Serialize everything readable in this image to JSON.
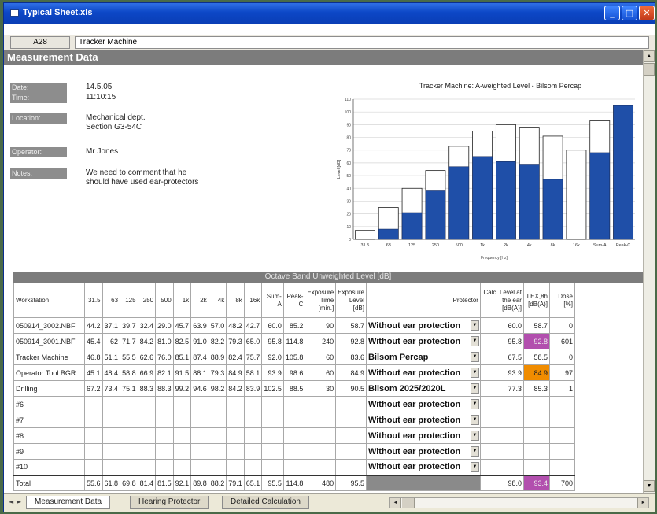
{
  "window": {
    "title": "Typical Sheet.xls",
    "min": "_",
    "max": "□",
    "close": "✕"
  },
  "formula_bar": {
    "cell_ref": "A28",
    "cell_value": "Tracker Machine"
  },
  "section_title": "Measurement Data",
  "info": [
    {
      "label": "Date:",
      "value": "14.5.05"
    },
    {
      "label": "Time:",
      "value": "11:10:15"
    },
    {
      "label": "Location:",
      "value": "Mechanical dept.\nSection G3-54C"
    },
    {
      "label": "Operator:",
      "value": "Mr Jones"
    },
    {
      "label": "Notes:",
      "value": "We need to comment that he\nshould have used ear-protectors"
    }
  ],
  "chart_data": {
    "type": "bar",
    "title": "Tracker Machine: A-weighted Level - Bilsom Percap",
    "xlabel": "Frequency [Hz]",
    "ylabel": "Level [dB]",
    "ylim": [
      0,
      110
    ],
    "yticks": [
      "0",
      "10",
      "20",
      "30",
      "40",
      "50",
      "60",
      "70",
      "80",
      "90",
      "100",
      "110"
    ],
    "categories": [
      "31.5",
      "63",
      "125",
      "250",
      "500",
      "1k",
      "2k",
      "4k",
      "8k",
      "16k",
      "Sum-A",
      "Peak-C"
    ],
    "series": [
      {
        "name": "",
        "values": [
          0,
          8,
          21,
          38,
          57,
          65,
          61,
          59,
          47,
          0,
          68,
          105
        ],
        "color": "#1f4fa8"
      },
      {
        "name": "",
        "values": [
          7,
          25,
          40,
          54,
          73,
          85,
          90,
          88,
          81,
          70,
          93,
          105
        ],
        "color": "#ffffff"
      }
    ],
    "grid": true
  },
  "octave_title": "Octave Band Unweighted Level [dB]",
  "table": {
    "headers": [
      "Workstation",
      "31.5",
      "63",
      "125",
      "250",
      "500",
      "1k",
      "2k",
      "4k",
      "8k",
      "16k",
      "Sum-A",
      "Peak-C",
      "Exposure Time [min.]",
      "Exposure Level [dB]",
      "Protector",
      "Calc. Level at the ear [dB(A)]",
      "LEX,8h [dB(A)]",
      "Dose [%]"
    ],
    "rows": [
      {
        "cells": [
          "050914_3002.NBF",
          "44.2",
          "37.1",
          "39.7",
          "32.4",
          "29.0",
          "45.7",
          "63.9",
          "57.0",
          "48.2",
          "42.7",
          "60.0",
          "85.2",
          "90",
          "58.7",
          "Without ear protection",
          "60.0",
          "58.7",
          "0"
        ],
        "hl": {}
      },
      {
        "cells": [
          "050914_3001.NBF",
          "45.4",
          "62",
          "71.7",
          "84.2",
          "81.0",
          "82.5",
          "91.0",
          "82.2",
          "79.3",
          "65.0",
          "95.8",
          "114.8",
          "240",
          "92.8",
          "Without ear protection",
          "95.8",
          "92.8",
          "601"
        ],
        "hl": {
          "17": "magenta"
        }
      },
      {
        "cells": [
          "Tracker Machine",
          "46.8",
          "51.1",
          "55.5",
          "62.6",
          "76.0",
          "85.1",
          "87.4",
          "88.9",
          "82.4",
          "75.7",
          "92.0",
          "105.8",
          "60",
          "83.6",
          "Bilsom Percap",
          "67.5",
          "58.5",
          "0"
        ],
        "hl": {}
      },
      {
        "cells": [
          "Operator Tool BGR",
          "45.1",
          "48.4",
          "58.8",
          "66.9",
          "82.1",
          "91.5",
          "88.1",
          "79.3",
          "84.9",
          "58.1",
          "93.9",
          "98.6",
          "60",
          "84.9",
          "Without ear protection",
          "93.9",
          "84.9",
          "97"
        ],
        "hl": {
          "17": "orange"
        }
      },
      {
        "cells": [
          "Drilling",
          "67.2",
          "73.4",
          "75.1",
          "88.3",
          "88.3",
          "99.2",
          "94.6",
          "98.2",
          "84.2",
          "83.9",
          "102.5",
          "88.5",
          "30",
          "90.5",
          "Bilsom 2025/2020L",
          "77.3",
          "85.3",
          "1"
        ],
        "hl": {}
      },
      {
        "cells": [
          "#6",
          "",
          "",
          "",
          "",
          "",
          "",
          "",
          "",
          "",
          "",
          "",
          "",
          "",
          "",
          "Without ear protection",
          "",
          "",
          ""
        ],
        "hl": {}
      },
      {
        "cells": [
          "#7",
          "",
          "",
          "",
          "",
          "",
          "",
          "",
          "",
          "",
          "",
          "",
          "",
          "",
          "",
          "Without ear protection",
          "",
          "",
          ""
        ],
        "hl": {}
      },
      {
        "cells": [
          "#8",
          "",
          "",
          "",
          "",
          "",
          "",
          "",
          "",
          "",
          "",
          "",
          "",
          "",
          "",
          "Without ear protection",
          "",
          "",
          ""
        ],
        "hl": {}
      },
      {
        "cells": [
          "#9",
          "",
          "",
          "",
          "",
          "",
          "",
          "",
          "",
          "",
          "",
          "",
          "",
          "",
          "",
          "Without ear protection",
          "",
          "",
          ""
        ],
        "hl": {}
      },
      {
        "cells": [
          "#10",
          "",
          "",
          "",
          "",
          "",
          "",
          "",
          "",
          "",
          "",
          "",
          "",
          "",
          "",
          "Without ear protection",
          "",
          "",
          ""
        ],
        "hl": {}
      }
    ],
    "total": {
      "cells": [
        "Total",
        "55.6",
        "61.8",
        "69.8",
        "81.4",
        "81.5",
        "92.1",
        "89.8",
        "88.2",
        "79.1",
        "65.1",
        "95.5",
        "114.8",
        "480",
        "95.5",
        "",
        "98.0",
        "93.4",
        "700"
      ],
      "hl": {
        "15": "gray",
        "17": "magenta"
      }
    }
  },
  "tabs": [
    {
      "label": "Measurement Data",
      "active": true
    },
    {
      "label": "Hearing Protector",
      "active": false
    },
    {
      "label": "Detailed Calculation",
      "active": false
    }
  ],
  "nav": {
    "prev": "◄",
    "next": "►"
  }
}
